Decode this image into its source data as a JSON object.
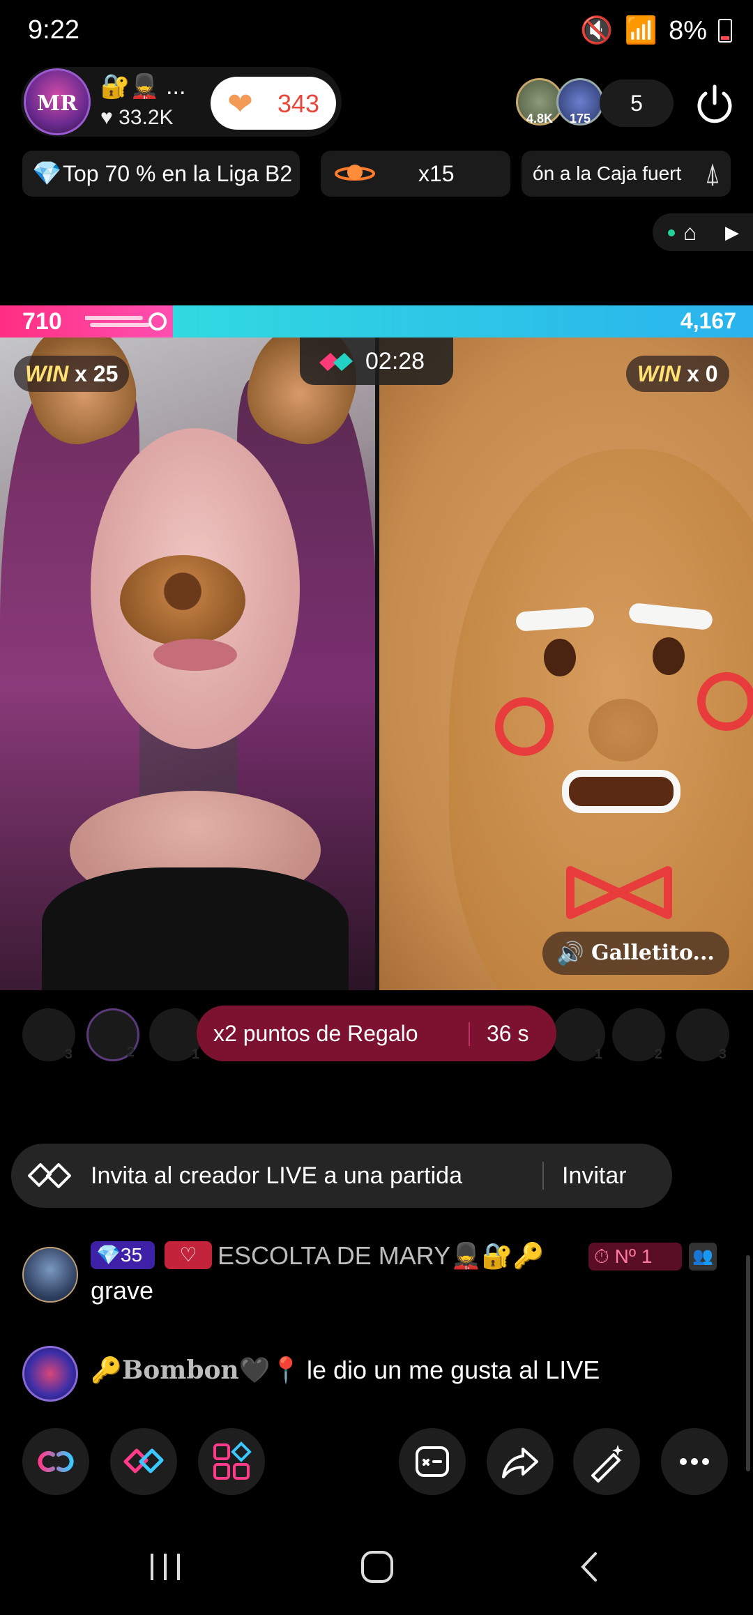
{
  "status_bar": {
    "time": "9:22",
    "battery": "8%"
  },
  "host": {
    "avatar_text": "MR",
    "icons": "🔐💂 ...",
    "likes": "♥ 33.2K",
    "heart_count": "343"
  },
  "viewers": {
    "avatar1": "4.8K",
    "avatar2": "175",
    "count": "5"
  },
  "chips": {
    "league": "Top 70 % en la Liga B2",
    "multiplier": "x15",
    "caja": "ón a la Caja fuert"
  },
  "battle": {
    "left_score": "710",
    "right_score": "4,167",
    "left_share": 0.23,
    "win_word": "WIN",
    "left_win": "x 25",
    "right_win": "x 0",
    "timer": "02:28",
    "right_label": "Galletito..."
  },
  "gift_points": {
    "text": "x2 puntos de Regalo",
    "seconds": "36 s",
    "slots": [
      "3",
      "2",
      "1",
      "1",
      "2",
      "3"
    ]
  },
  "invite": {
    "text": "Invita al creador LIVE a una partida",
    "button": "Invitar"
  },
  "chat": [
    {
      "badge_level": "35",
      "name": "ESCOLTA DE MARY💂🔐🔑",
      "badge_rank": "Nº 1",
      "message": "grave"
    },
    {
      "name": "🔑Bombon🖤📍",
      "message": "le dio un me gusta al LIVE"
    }
  ],
  "colors": {
    "left_team": "#ff2e82",
    "right_team": "#2ab3ee",
    "gift_pill": "#7d1230"
  }
}
